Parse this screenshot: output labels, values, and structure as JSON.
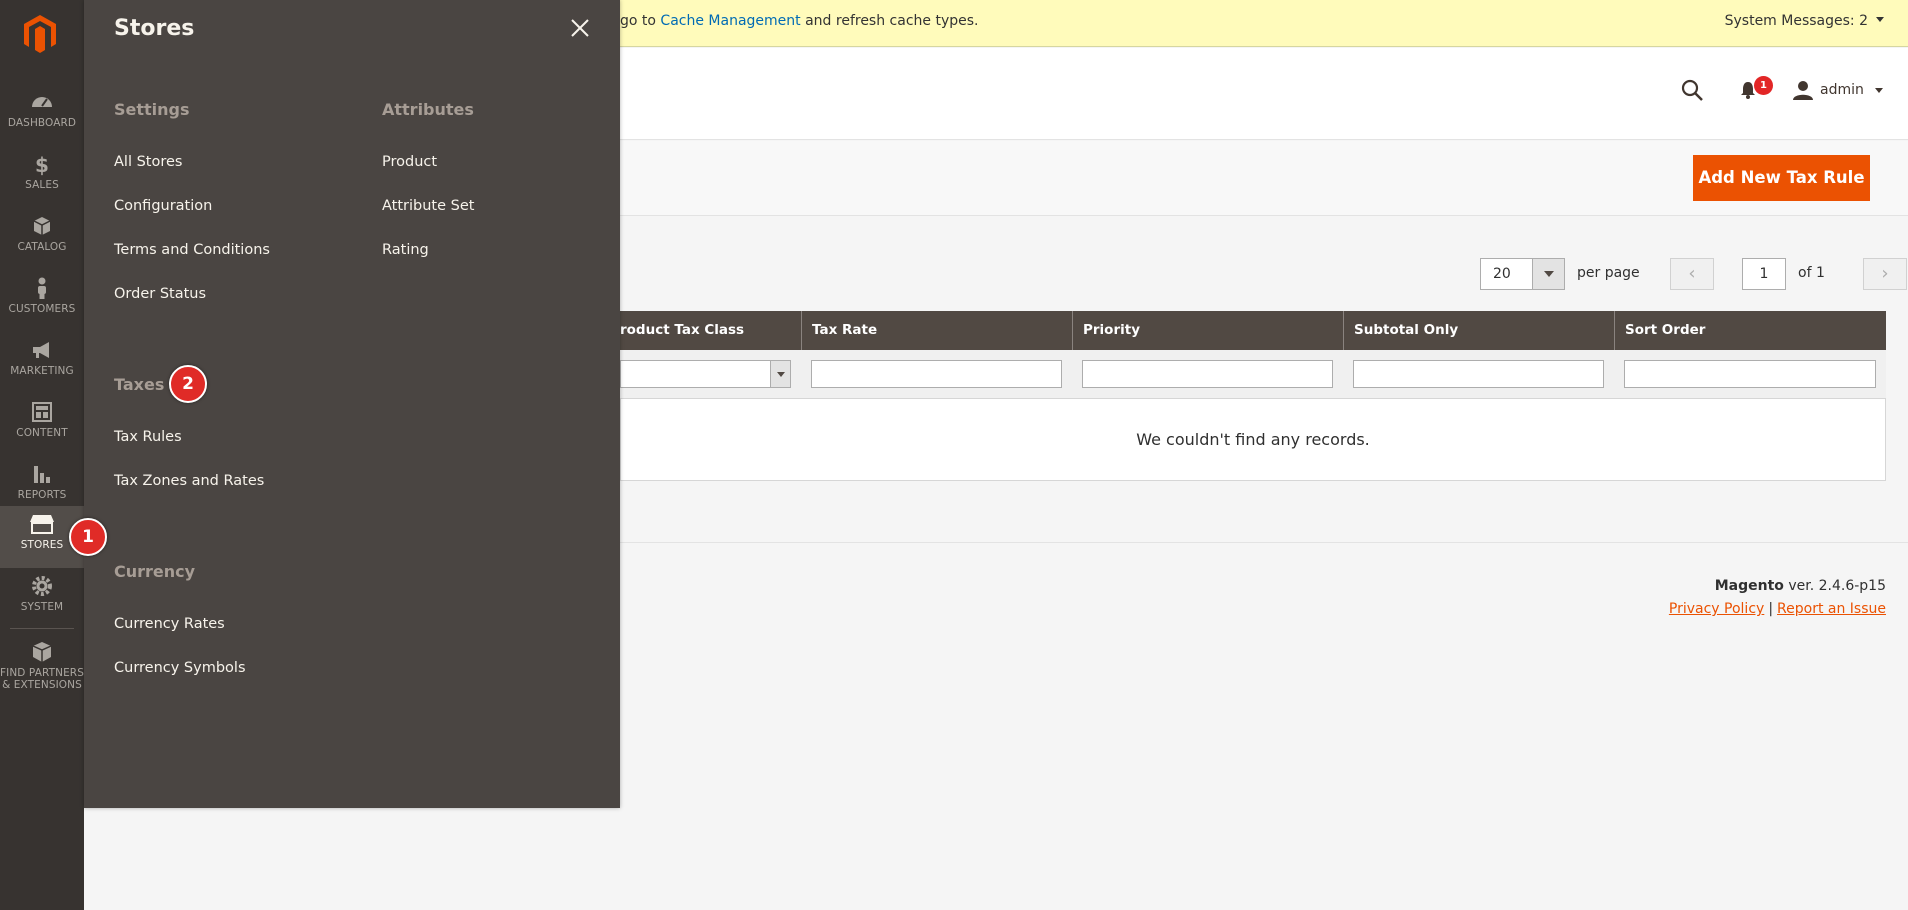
{
  "nav": {
    "items": [
      {
        "label": "DASHBOARD",
        "icon": "dashboard-icon"
      },
      {
        "label": "SALES",
        "icon": "dollar-icon"
      },
      {
        "label": "CATALOG",
        "icon": "cube-icon"
      },
      {
        "label": "CUSTOMERS",
        "icon": "person-icon"
      },
      {
        "label": "MARKETING",
        "icon": "megaphone-icon"
      },
      {
        "label": "CONTENT",
        "icon": "layout-icon"
      },
      {
        "label": "REPORTS",
        "icon": "bar-chart-icon"
      },
      {
        "label": "STORES",
        "icon": "storefront-icon"
      },
      {
        "label": "SYSTEM",
        "icon": "gear-icon"
      },
      {
        "label_line1": "FIND PARTNERS",
        "label_line2": "& EXTENSIONS",
        "icon": "box-icon"
      }
    ],
    "active": "STORES"
  },
  "flyout": {
    "title": "Stores",
    "groups": {
      "settings": {
        "title": "Settings",
        "links": [
          "All Stores",
          "Configuration",
          "Terms and Conditions",
          "Order Status"
        ]
      },
      "attributes": {
        "title": "Attributes",
        "links": [
          "Product",
          "Attribute Set",
          "Rating"
        ]
      },
      "taxes": {
        "title": "Taxes",
        "links": [
          "Tax Rules",
          "Tax Zones and Rates"
        ]
      },
      "currency": {
        "title": "Currency",
        "links": [
          "Currency Rates",
          "Currency Symbols"
        ]
      }
    }
  },
  "badges": {
    "step1": "1",
    "step2": "2"
  },
  "system_message": {
    "prefix": "go to ",
    "link": "Cache Management",
    "suffix": " and refresh cache types.",
    "count_label": "System Messages: 2"
  },
  "header": {
    "notifications_count": "1",
    "user": "admin"
  },
  "actions": {
    "add_label": "Add New Tax Rule"
  },
  "pager": {
    "per_page_value": "20",
    "per_page_label": "per page",
    "current_page": "1",
    "of_label": "of 1",
    "prev": "‹",
    "next": "›"
  },
  "grid": {
    "columns": [
      "roduct Tax Class",
      "Tax Rate",
      "Priority",
      "Subtotal Only",
      "Sort Order"
    ],
    "empty_text": "We couldn't find any records."
  },
  "footer": {
    "brand": "Magento",
    "version": " ver. 2.4.6-p15",
    "privacy": "Privacy Policy",
    "separator": "|",
    "report": "Report an Issue"
  }
}
